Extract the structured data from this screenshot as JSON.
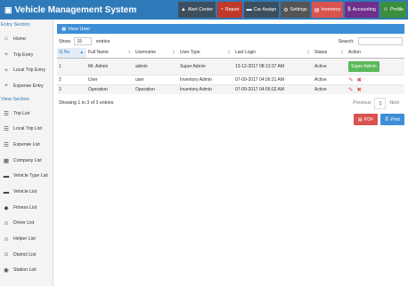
{
  "app": {
    "title": "Vehicle Management System"
  },
  "topnav": [
    {
      "label": "Alert Center",
      "icon": "bell-icon",
      "glyph": "▲",
      "color": "#3d4f5f"
    },
    {
      "label": "Report",
      "icon": "chart-icon",
      "glyph": "◔",
      "color": "#c0392b"
    },
    {
      "label": "Car Assign",
      "icon": "car-icon",
      "glyph": "▬",
      "color": "#3d4f5f"
    },
    {
      "label": "Settings",
      "icon": "gear-icon",
      "glyph": "⚙",
      "color": "#555555"
    },
    {
      "label": "Inventory",
      "icon": "inventory-icon",
      "glyph": "▤",
      "color": "#d9534f"
    },
    {
      "label": "Accounting",
      "icon": "dollar-icon",
      "glyph": "$",
      "color": "#6f2f8a"
    },
    {
      "label": "Profile",
      "icon": "user-icon",
      "glyph": "☺",
      "color": "#3c8d3c"
    }
  ],
  "sidebar": {
    "entry_section": "Entry Section",
    "entry_items": [
      {
        "label": "Home",
        "icon": "home-icon",
        "glyph": "⌂"
      },
      {
        "label": "Trip Entry",
        "icon": "plus-icon",
        "glyph": "+"
      },
      {
        "label": "Local Trip Entry",
        "icon": "plus-icon",
        "glyph": "+"
      },
      {
        "label": "Expense Entry",
        "icon": "plus-icon",
        "glyph": "+"
      }
    ],
    "view_section": "View Section",
    "view_items": [
      {
        "label": "Trip List",
        "icon": "list-icon",
        "glyph": "☰"
      },
      {
        "label": "Local Trip List",
        "icon": "list-icon",
        "glyph": "☰"
      },
      {
        "label": "Expense List",
        "icon": "list-icon",
        "glyph": "☰"
      },
      {
        "label": "Company List",
        "icon": "building-icon",
        "glyph": "▦"
      },
      {
        "label": "Vehicle Type List",
        "icon": "car-icon",
        "glyph": "▬"
      },
      {
        "label": "Vehicle List",
        "icon": "car-icon",
        "glyph": "▬"
      },
      {
        "label": "Fitness List",
        "icon": "tag-icon",
        "glyph": "◆"
      },
      {
        "label": "Driver List",
        "icon": "user-icon",
        "glyph": "☺"
      },
      {
        "label": "Helper List",
        "icon": "user-icon",
        "glyph": "☺"
      },
      {
        "label": "District List",
        "icon": "user-icon",
        "glyph": "☺"
      },
      {
        "label": "Station List",
        "icon": "location-icon",
        "glyph": "◉"
      }
    ]
  },
  "panel": {
    "title": "View User"
  },
  "controls": {
    "show": "Show",
    "entries_value": "15",
    "entries": "entries",
    "search_label": "Search:",
    "search_value": ""
  },
  "table": {
    "columns": [
      "Sl No",
      "Full Name",
      "Username",
      "User Type",
      "Last Login",
      "Status",
      "Action"
    ],
    "rows": [
      {
        "sl": "1",
        "name": "Mr. Admin",
        "username": "admin",
        "type": "Super Admin",
        "login": "13-12-2017 08:13:37 AM",
        "status": "Active",
        "action": "Super Admin"
      },
      {
        "sl": "2",
        "name": "User",
        "username": "user",
        "type": "Inventory Admin",
        "login": "07-09-2017 04:06:21 AM",
        "status": "Active",
        "action": ""
      },
      {
        "sl": "3",
        "name": "Operation",
        "username": "Operation",
        "type": "Inventory Admin",
        "login": "07-09-2017 04:06:02 AM",
        "status": "Active",
        "action": ""
      }
    ]
  },
  "footer": {
    "info": "Showing 1 to 3 of 3 entries",
    "previous": "Previous",
    "page": "1",
    "next": "Next"
  },
  "exports": {
    "pdf": "PDF",
    "print": "Print"
  }
}
